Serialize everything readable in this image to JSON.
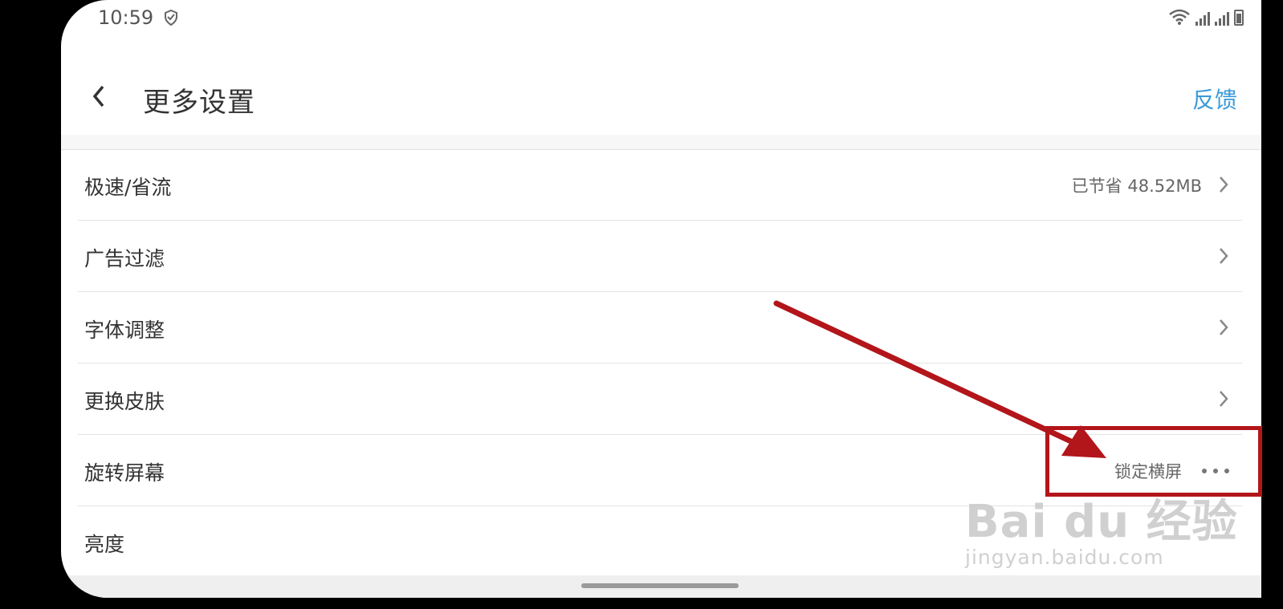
{
  "status_bar": {
    "time": "10:59"
  },
  "header": {
    "back_icon": "chevron-left-icon",
    "title": "更多设置",
    "feedback": "反馈"
  },
  "settings": [
    {
      "label": "极速/省流",
      "value": "已节省 48.52MB"
    },
    {
      "label": "广告过滤"
    },
    {
      "label": "字体调整"
    },
    {
      "label": "更换皮肤"
    },
    {
      "label": "旋转屏幕",
      "value": "锁定横屏"
    },
    {
      "label": "亮度"
    }
  ],
  "watermark": {
    "brand": "Bai du 经验",
    "url": "jingyan.baidu.com"
  },
  "colors": {
    "accent": "#3a9ad9",
    "annotation_red": "#b2151a"
  }
}
